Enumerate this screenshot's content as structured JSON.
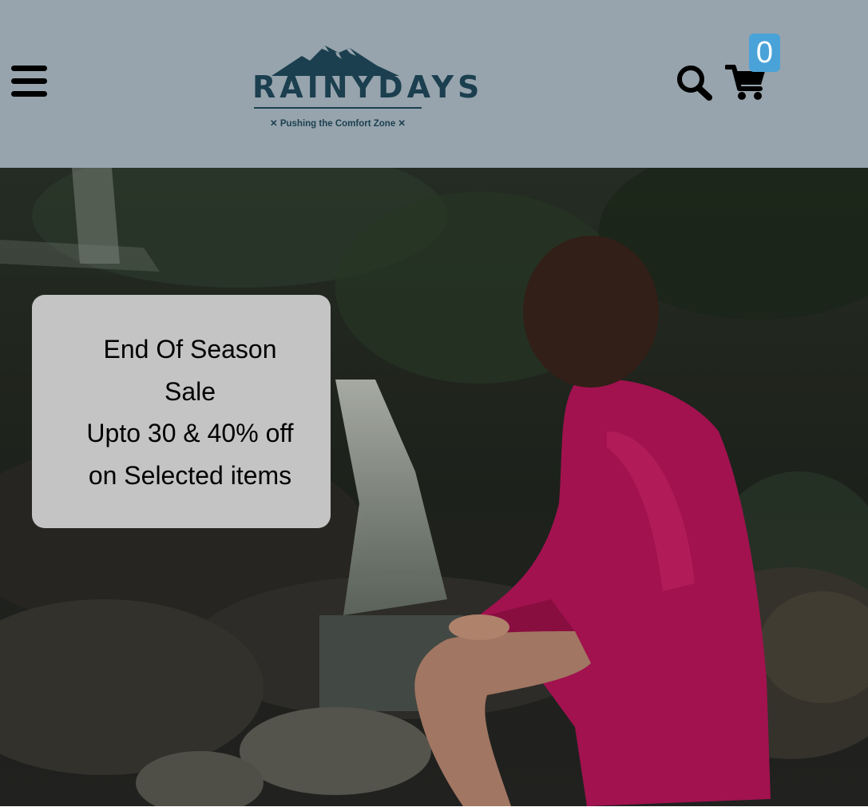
{
  "header": {
    "menu_icon": "hamburger-menu-icon",
    "logo": {
      "brand": "RAINYDAYS",
      "tagline": "✕ Pushing the Comfort Zone ✕"
    },
    "search_icon": "magnifying-glass-icon",
    "cart_icon": "shopping-cart-icon",
    "cart_count": "0",
    "background_color": "#97a4ad",
    "badge_color": "#4aa3d8"
  },
  "hero": {
    "image_description_icon": "hero-photo",
    "promo": {
      "line1": "End Of Season",
      "line2": "Sale",
      "line3": "Upto 30 & 40% off",
      "line4": "on Selected items"
    },
    "jacket_color": "#c2185b"
  }
}
